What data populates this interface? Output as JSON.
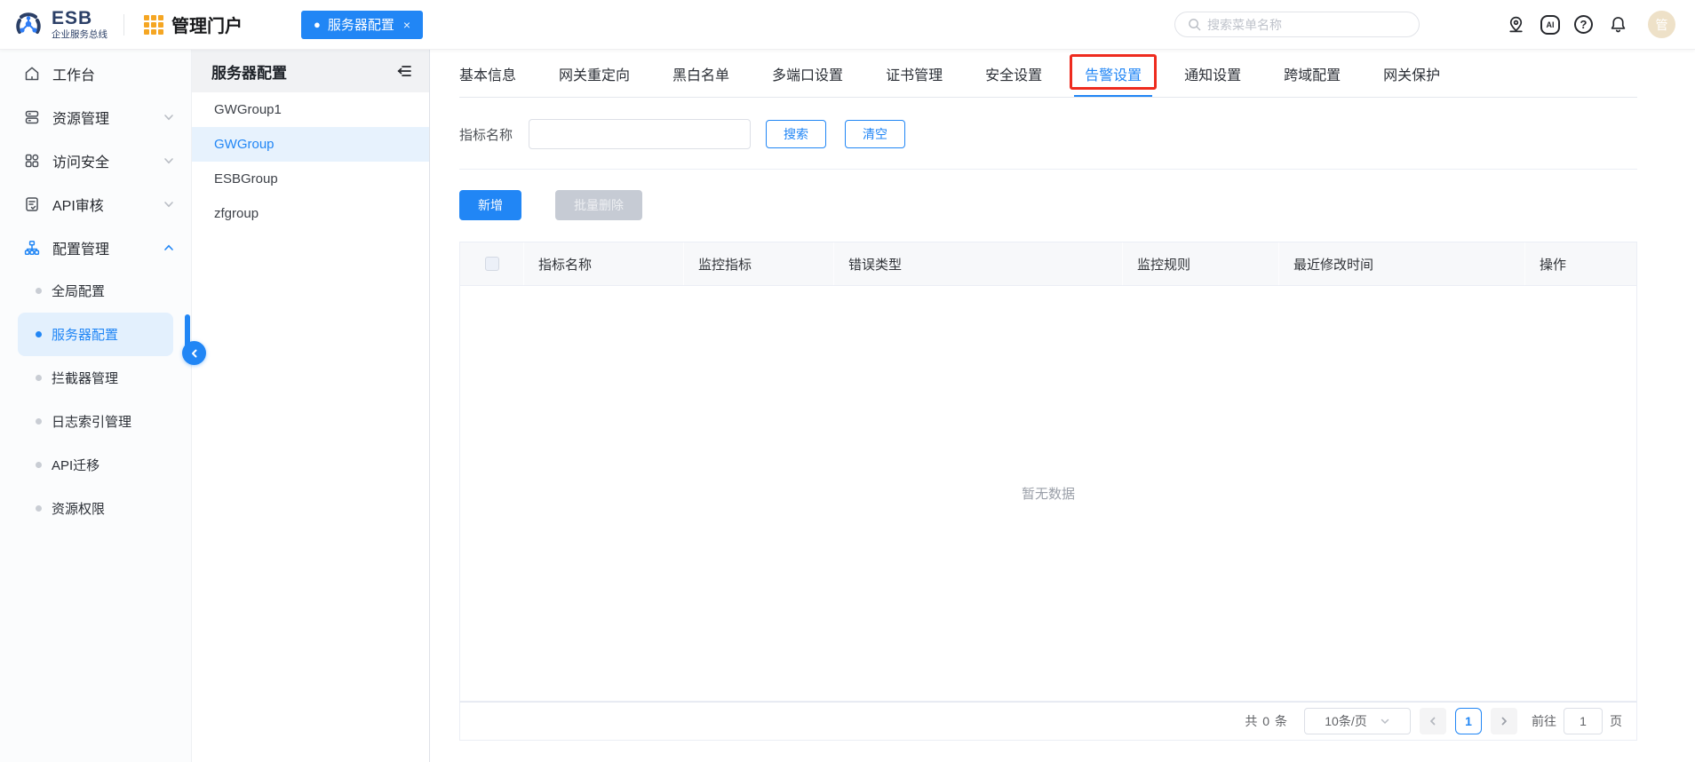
{
  "topbar": {
    "logo_title": "ESB",
    "logo_subtitle": "企业服务总线",
    "portal_title": "管理门户",
    "open_tab": {
      "dot": "●",
      "label": "服务器配置",
      "close": "×"
    },
    "search_placeholder": "搜索菜单名称",
    "ai_label": "AI",
    "help_glyph": "?",
    "avatar_text": "管"
  },
  "sidebar": {
    "items": [
      {
        "label": "工作台"
      },
      {
        "label": "资源管理"
      },
      {
        "label": "访问安全"
      },
      {
        "label": "API审核"
      },
      {
        "label": "配置管理"
      }
    ],
    "subitems": [
      {
        "label": "全局配置"
      },
      {
        "label": "服务器配置"
      },
      {
        "label": "拦截器管理"
      },
      {
        "label": "日志索引管理"
      },
      {
        "label": "API迁移"
      },
      {
        "label": "资源权限"
      }
    ]
  },
  "panel": {
    "title": "服务器配置",
    "items": [
      {
        "label": "GWGroup1"
      },
      {
        "label": "GWGroup"
      },
      {
        "label": "ESBGroup"
      },
      {
        "label": "zfgroup"
      }
    ]
  },
  "tabs": [
    {
      "label": "基本信息"
    },
    {
      "label": "网关重定向"
    },
    {
      "label": "黑白名单"
    },
    {
      "label": "多端口设置"
    },
    {
      "label": "证书管理"
    },
    {
      "label": "安全设置"
    },
    {
      "label": "告警设置"
    },
    {
      "label": "通知设置"
    },
    {
      "label": "跨域配置"
    },
    {
      "label": "网关保护"
    }
  ],
  "filter": {
    "label": "指标名称",
    "value": "",
    "search_label": "搜索",
    "clear_label": "清空"
  },
  "actions": {
    "add_label": "新增",
    "batch_delete_label": "批量删除"
  },
  "table": {
    "columns": [
      "指标名称",
      "监控指标",
      "错误类型",
      "监控规则",
      "最近修改时间",
      "操作"
    ],
    "empty_text": "暂无数据"
  },
  "pagination": {
    "total_text": "共 0 条",
    "page_size": "10条/页",
    "current_page": "1",
    "goto_label": "前往",
    "goto_value": "1",
    "unit_label": "页"
  },
  "colors": {
    "primary": "#2186f5",
    "annotation_red": "#ee2b1e",
    "active_item_bg": "#e3f0fd",
    "table_header_bg": "#f7f8fa"
  }
}
